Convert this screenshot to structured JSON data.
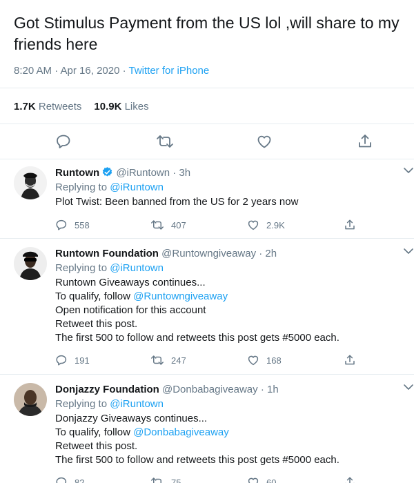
{
  "main_tweet": {
    "text": "Got Stimulus Payment from the US lol ,will share to my friends here",
    "time": "8:20 AM · Apr 16, 2020 · ",
    "client": "Twitter for iPhone",
    "retweets_count": "1.7K",
    "retweets_label": "Retweets",
    "likes_count": "10.9K",
    "likes_label": "Likes"
  },
  "replies": [
    {
      "name": "Runtown",
      "verified": true,
      "handle": "@iRuntown · 3h",
      "replying_prefix": "Replying to ",
      "replying_to": "@iRuntown",
      "lines": [
        "Plot Twist: Been banned from the US for 2 years now"
      ],
      "replies": "558",
      "retweets": "407",
      "likes": "2.9K"
    },
    {
      "name": "Runtown Foundation",
      "verified": false,
      "handle": "@Runtowngiveaway · 2h",
      "replying_prefix": "Replying to ",
      "replying_to": "@iRuntown",
      "lines": [
        "Runtown Giveaways continues...",
        "To qualify, follow ",
        "Open notification for this account",
        "Retweet this post.",
        "The first 500 to follow and retweets this post gets #5000 each."
      ],
      "mention": "@Runtowngiveaway",
      "replies": "191",
      "retweets": "247",
      "likes": "168"
    },
    {
      "name": "Donjazzy Foundation",
      "verified": false,
      "handle": "@Donbabagiveaway · 1h",
      "replying_prefix": "Replying to ",
      "replying_to": "@iRuntown",
      "lines": [
        "Donjazzy Giveaways continues...",
        "To qualify, follow ",
        "Retweet this post.",
        "The first 500 to follow and retweets this post gets #5000 each."
      ],
      "mention": "@Donbabagiveaway",
      "replies": "82",
      "retweets": "75",
      "likes": "60"
    }
  ],
  "colors": {
    "accent": "#1da1f2",
    "text": "#14171a",
    "secondary": "#657786",
    "divider": "#e6ecf0"
  },
  "icons": [
    "reply-icon",
    "retweet-icon",
    "like-icon",
    "share-icon",
    "chevron-down-icon",
    "verified-badge-icon"
  ]
}
